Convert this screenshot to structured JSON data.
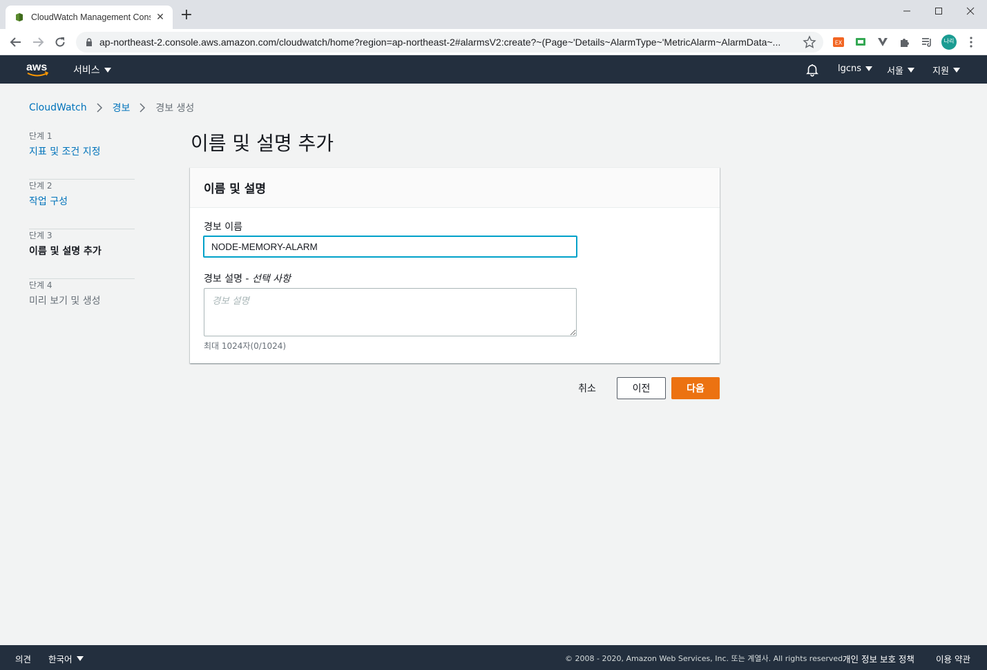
{
  "browser": {
    "tab_title": "CloudWatch Management Cons",
    "url": "ap-northeast-2.console.aws.amazon.com/cloudwatch/home?region=ap-northeast-2#alarmsV2:create?~(Page~'Details~AlarmType~'MetricAlarm~AlarmData~...",
    "profile_label": "나리"
  },
  "aws_header": {
    "services": "서비스",
    "account": "lgcns",
    "region": "서울",
    "support": "지원"
  },
  "breadcrumb": {
    "items": [
      "CloudWatch",
      "경보",
      "경보 생성"
    ]
  },
  "steps": [
    {
      "num": "단계 1",
      "label": "지표 및 조건 지정"
    },
    {
      "num": "단계 2",
      "label": "작업 구성"
    },
    {
      "num": "단계 3",
      "label": "이름 및 설명 추가"
    },
    {
      "num": "단계 4",
      "label": "미리 보기 및 생성"
    }
  ],
  "main": {
    "title": "이름 및 설명 추가",
    "panel_title": "이름 및 설명",
    "name_label": "경보 이름",
    "name_value": "NODE-MEMORY-ALARM",
    "desc_label": "경보 설명 - ",
    "desc_optional": "선택 사항",
    "desc_placeholder": "경보 설명",
    "desc_hint": "최대 1024자(0/1024)"
  },
  "buttons": {
    "cancel": "취소",
    "previous": "이전",
    "next": "다음"
  },
  "footer": {
    "feedback": "의견",
    "language": "한국어",
    "copyright": "© 2008 - 2020, Amazon Web Services, Inc. 또는 계열사. All rights reserved.",
    "privacy": "개인 정보 보호 정책",
    "terms": "이용 약관"
  },
  "colors": {
    "aws_nav": "#232f3e",
    "link": "#0073bb",
    "primary_button": "#ec7211",
    "focus_border": "#00a1c9"
  }
}
